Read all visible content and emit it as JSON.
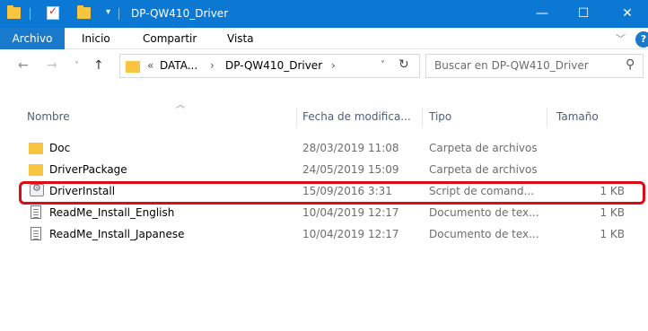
{
  "window": {
    "title": "DP-QW410_Driver",
    "minimize": "—",
    "maximize": "☐",
    "close": "✕"
  },
  "ribbon": {
    "tabs": [
      "Archivo",
      "Inicio",
      "Compartir",
      "Vista"
    ],
    "help": "?"
  },
  "address": {
    "crumbs": [
      "«",
      "DATA...",
      "›",
      "DP-QW410_Driver",
      "›"
    ],
    "search_placeholder": "Buscar en DP-QW410_Driver"
  },
  "columns": {
    "name": "Nombre",
    "date": "Fecha de modifica...",
    "type": "Tipo",
    "size": "Tamaño"
  },
  "files": [
    {
      "name": "Doc",
      "date": "28/03/2019 11:08",
      "type": "Carpeta de archivos",
      "size": "",
      "icon": "folder-icon"
    },
    {
      "name": "DriverPackage",
      "date": "24/05/2019 15:09",
      "type": "Carpeta de archivos",
      "size": "",
      "icon": "folder-icon"
    },
    {
      "name": "DriverInstall",
      "date": "15/09/2016 3:31",
      "type": "Script de comand...",
      "size": "1 KB",
      "icon": "script-icon"
    },
    {
      "name": "ReadMe_Install_English",
      "date": "10/04/2019 12:17",
      "type": "Documento de tex...",
      "size": "1 KB",
      "icon": "text-document-icon"
    },
    {
      "name": "ReadMe_Install_Japanese",
      "date": "10/04/2019 12:17",
      "type": "Documento de tex...",
      "size": "1 KB",
      "icon": "text-document-icon"
    }
  ],
  "colors": {
    "titlebar": "#0b78d4",
    "file_tab": "#1979ca",
    "highlight": "#e00a17",
    "folder": "#f8c540"
  }
}
